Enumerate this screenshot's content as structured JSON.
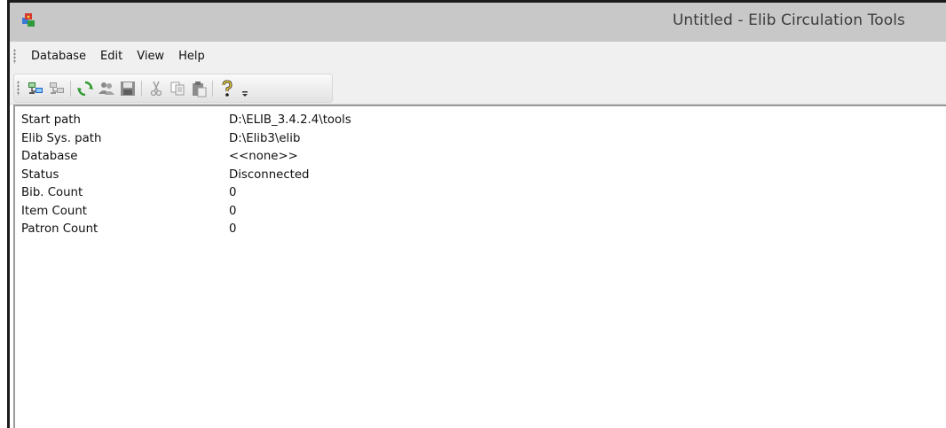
{
  "window": {
    "title": "Untitled - Elib Circulation Tools"
  },
  "menu": {
    "items": [
      "Database",
      "Edit",
      "View",
      "Help"
    ]
  },
  "toolbar": {
    "buttons": [
      "connect-database-icon",
      "disconnect-database-icon",
      "refresh-icon",
      "users-icon",
      "save-icon",
      "cut-icon",
      "copy-icon",
      "paste-icon",
      "help-icon"
    ]
  },
  "properties": [
    {
      "label": "Start path",
      "value": "D:\\ELIB_3.4.2.4\\tools"
    },
    {
      "label": "Elib Sys. path",
      "value": "D:\\Elib3\\elib"
    },
    {
      "label": "Database",
      "value": "<<none>>"
    },
    {
      "label": "Status",
      "value": "Disconnected"
    },
    {
      "label": "Bib. Count",
      "value": "0"
    },
    {
      "label": "Item Count",
      "value": "0"
    },
    {
      "label": "Patron Count",
      "value": "0"
    }
  ]
}
